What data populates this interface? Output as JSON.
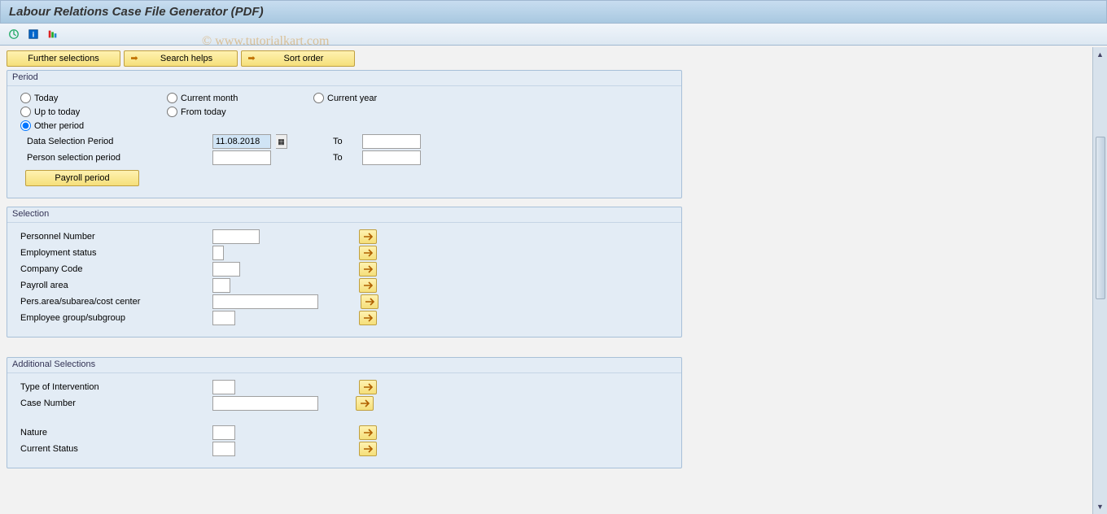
{
  "header": {
    "title": "Labour Relations Case File Generator (PDF)",
    "watermark": "© www.tutorialkart.com"
  },
  "buttons": {
    "further_selections": "Further selections",
    "search_helps": "Search helps",
    "sort_order": "Sort order",
    "payroll_period": "Payroll period"
  },
  "period": {
    "title": "Period",
    "today": "Today",
    "current_month": "Current month",
    "current_year": "Current year",
    "up_to_today": "Up to today",
    "from_today": "From today",
    "other_period": "Other period",
    "data_selection_period": "Data Selection Period",
    "person_selection_period": "Person selection period",
    "to": "To",
    "date_value": "11.08.2018"
  },
  "selection": {
    "title": "Selection",
    "personnel_number": "Personnel Number",
    "employment_status": "Employment status",
    "company_code": "Company Code",
    "payroll_area": "Payroll area",
    "pers_area": "Pers.area/subarea/cost center",
    "employee_group": "Employee group/subgroup"
  },
  "additional": {
    "title": "Additional Selections",
    "type_of_intervention": "Type of Intervention",
    "case_number": "Case Number",
    "nature": "Nature",
    "current_status": "Current Status"
  }
}
